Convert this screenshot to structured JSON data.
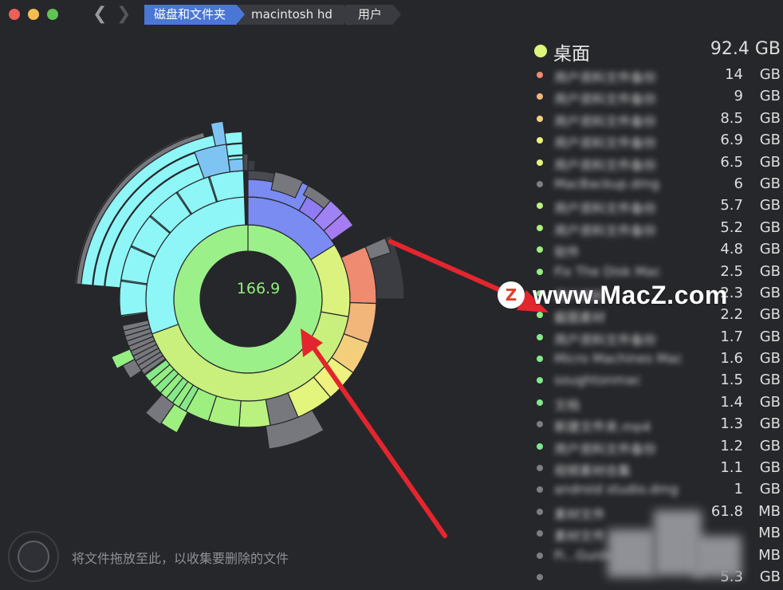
{
  "window": {
    "traffic_lights": [
      {
        "name": "close",
        "color": "#ed5f58"
      },
      {
        "name": "minimize",
        "color": "#f4be4f"
      },
      {
        "name": "zoom",
        "color": "#5fc454"
      }
    ]
  },
  "breadcrumb": [
    "磁盘和文件夹",
    "macintosh hd",
    "用户"
  ],
  "chart": {
    "center_value": "166.9"
  },
  "panel": {
    "title": "桌面",
    "size": "92.4 GB",
    "title_color": "#dcf57a",
    "items": [
      {
        "name": "用户资料文件备份",
        "value": "14",
        "unit": "GB",
        "color": "#ef8b70"
      },
      {
        "name": "用户资料文件备份",
        "value": "9",
        "unit": "GB",
        "color": "#f2b57a"
      },
      {
        "name": "用户资料文件备份",
        "value": "8.5",
        "unit": "GB",
        "color": "#f3cf7c"
      },
      {
        "name": "用户资料文件备份",
        "value": "6.9",
        "unit": "GB",
        "color": "#eef27e"
      },
      {
        "name": "用户资料文件备份",
        "value": "6.5",
        "unit": "GB",
        "color": "#e4f57d"
      },
      {
        "name": "MacBackup.dmg",
        "value": "6",
        "unit": "GB",
        "color": "#7d7e83"
      },
      {
        "name": "用户资料文件备份",
        "value": "5.7",
        "unit": "GB",
        "color": "#baf27f"
      },
      {
        "name": "用户资料文件备份",
        "value": "5.2",
        "unit": "GB",
        "color": "#a9f07e"
      },
      {
        "name": "软件",
        "value": "4.8",
        "unit": "GB",
        "color": "#9def80"
      },
      {
        "name": "Fix The Disk Mac",
        "value": "2.5",
        "unit": "GB",
        "color": "#95ee82"
      },
      {
        "name": "用户资料",
        "value": "2.3",
        "unit": "GB",
        "color": "#8fec84"
      },
      {
        "name": "截图素材",
        "value": "2.2",
        "unit": "GB",
        "color": "#8ceb85"
      },
      {
        "name": "用户资料文件备份",
        "value": "1.7",
        "unit": "GB",
        "color": "#88ea86"
      },
      {
        "name": "Micro Machines Mac",
        "value": "1.6",
        "unit": "GB",
        "color": "#86e988"
      },
      {
        "name": "soughtonmac",
        "value": "1.5",
        "unit": "GB",
        "color": "#84e889"
      },
      {
        "name": "文档",
        "value": "1.4",
        "unit": "GB",
        "color": "#82e78a"
      },
      {
        "name": "新建文件夹.mp4",
        "value": "1.3",
        "unit": "GB",
        "color": "#7d7e83"
      },
      {
        "name": "用户资料文件备份",
        "value": "1.2",
        "unit": "GB",
        "color": "#80e68b"
      },
      {
        "name": "视频素材合集",
        "value": "1.1",
        "unit": "GB",
        "color": "#7d7e83"
      },
      {
        "name": "android studio.dmg",
        "value": "1",
        "unit": "GB",
        "color": "#7d7e83"
      },
      {
        "name": "素材文件",
        "value": "61.8",
        "unit": "MB",
        "color": "#7d7e83"
      },
      {
        "name": "素材文件",
        "value": "",
        "unit": "MB",
        "color": "#7d7e83"
      },
      {
        "name": "Fi...Guide",
        "value": "",
        "unit": "MB",
        "color": "#7d7e83"
      },
      {
        "name": "",
        "value": "5.3",
        "unit": "GB",
        "color": "#7d7e83"
      }
    ]
  },
  "drop_hint": "将文件拖放至此，以收集要删除的文件",
  "watermark": {
    "logo": "Z",
    "text": "www.MacZ.com"
  }
}
